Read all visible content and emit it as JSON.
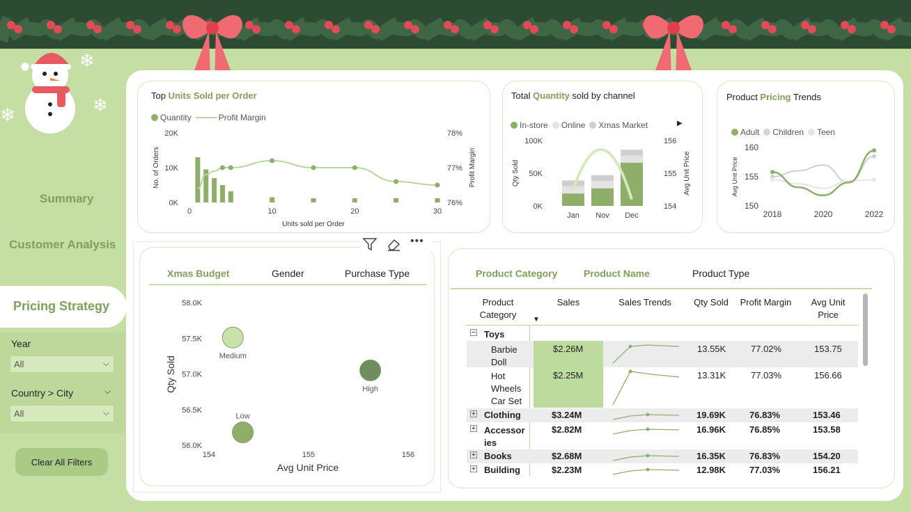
{
  "sidebar": {
    "nav": [
      {
        "label": "Summary"
      },
      {
        "label": "Customer Analysis"
      },
      {
        "label": "Pricing Strategy"
      }
    ],
    "filters": [
      {
        "label": "Year",
        "value": "All"
      },
      {
        "label": "Country > City",
        "value": "All"
      }
    ],
    "clear_label": "Clear All Filters"
  },
  "cards": {
    "units": {
      "title_pre": "Top ",
      "title_hl": "Units Sold per Order",
      "legend": [
        "Quantity",
        "Profit Margin"
      ]
    },
    "channel": {
      "title_pre": "Total ",
      "title_hl": "Quantity",
      "title_post": " sold by channel",
      "legend": [
        "In-store",
        "Online",
        "Xmas Market"
      ]
    },
    "pricing": {
      "title_pre": "Product ",
      "title_hl": "Pricing",
      "title_post": " Trends",
      "legend": [
        "Adult",
        "Children",
        "Teen"
      ]
    }
  },
  "visual_toolbar": {
    "icons": [
      "filter-icon",
      "eraser-icon",
      "more-icon"
    ]
  },
  "scatter_tabs": [
    "Xmas Budget",
    "Gender",
    "Purchase Type"
  ],
  "table_tabs": [
    "Product Category",
    "Product Name",
    "Product Type"
  ],
  "table": {
    "headers": [
      "Product\nCategory",
      "Sales",
      "Sales Trends",
      "Qty Sold",
      "Profit Margin",
      "Avg Unit\nPrice"
    ],
    "group": "Toys",
    "children": [
      {
        "name": "Barbie Doll",
        "sales": "$2.26M",
        "qty": "13.55K",
        "margin": "77.02%",
        "price": "153.75"
      },
      {
        "name": "Hot Wheels Car Set",
        "sales": "$2.25M",
        "qty": "13.31K",
        "margin": "77.03%",
        "price": "156.66"
      }
    ],
    "rows": [
      {
        "name": "Clothing",
        "sales": "$3.24M",
        "qty": "19.69K",
        "margin": "76.83%",
        "price": "153.46"
      },
      {
        "name": "Accessories",
        "sales": "$2.82M",
        "qty": "16.96K",
        "margin": "76.85%",
        "price": "153.58"
      },
      {
        "name": "Books",
        "sales": "$2.68M",
        "qty": "16.35K",
        "margin": "76.83%",
        "price": "154.20"
      },
      {
        "name": "Building",
        "sales": "$2.23M",
        "qty": "12.98K",
        "margin": "77.03%",
        "price": "156.21"
      }
    ]
  },
  "chart_data": [
    {
      "type": "bar",
      "title": "Top Units Sold per Order",
      "xlabel": "Units sold per Order",
      "ylabel": "No. of Orders",
      "y2label": "Profit Margin",
      "xticks": [
        "0",
        "10",
        "20",
        "30"
      ],
      "yticks": [
        "20K",
        "10K",
        "0K"
      ],
      "y2ticks": [
        "78%",
        "77%",
        "76%"
      ],
      "ylim": [
        0,
        20000
      ],
      "y2lim": [
        76,
        78
      ],
      "x": [
        1,
        2,
        3,
        4,
        5,
        10,
        15,
        20,
        25,
        30
      ],
      "series": [
        {
          "name": "Quantity",
          "values": [
            13000,
            9500,
            7000,
            5000,
            3200,
            1500,
            1200,
            1100,
            500,
            400
          ]
        },
        {
          "name": "Profit Margin",
          "values": [
            76.4,
            76.8,
            76.9,
            77.0,
            77.0,
            77.2,
            77.0,
            77.0,
            76.6,
            76.5
          ]
        }
      ]
    },
    {
      "type": "bar",
      "title": "Total Quantity sold by channel",
      "ylabel": "Qty Sold",
      "y2label": "Avg Unit Price",
      "categories": [
        "Jan",
        "Nov",
        "Dec"
      ],
      "yticks": [
        "100K",
        "50K",
        "0K"
      ],
      "y2ticks": [
        "156",
        "155",
        "154"
      ],
      "ylim": [
        0,
        100000
      ],
      "y2lim": [
        154,
        156
      ],
      "series": [
        {
          "name": "In-store",
          "values": [
            19000,
            27000,
            66000
          ]
        },
        {
          "name": "Online",
          "values": [
            11000,
            11000,
            11000
          ]
        },
        {
          "name": "Xmas Market",
          "values": [
            9000,
            9000,
            9000
          ]
        }
      ],
      "line": [
        154.5,
        155.6,
        154.2
      ]
    },
    {
      "type": "line",
      "title": "Product Pricing Trends",
      "ylabel": "Avg Unit Price",
      "x": [
        2018,
        2019,
        2020,
        2021,
        2022
      ],
      "xticks": [
        "2018",
        "2020",
        "2022"
      ],
      "yticks": [
        "160",
        "155",
        "150"
      ],
      "ylim": [
        150,
        160
      ],
      "series": [
        {
          "name": "Adult",
          "values": [
            155.8,
            153.2,
            151.8,
            154.0,
            159.5
          ]
        },
        {
          "name": "Children",
          "values": [
            155.0,
            156.0,
            157.0,
            154.0,
            158.5
          ]
        },
        {
          "name": "Teen",
          "values": [
            154.5,
            153.8,
            153.0,
            154.3,
            154.5
          ]
        }
      ]
    },
    {
      "type": "scatter",
      "xlabel": "Avg Unit Price",
      "ylabel": "Qty Sold",
      "xticks": [
        "154",
        "155",
        "156"
      ],
      "yticks": [
        "58.0K",
        "57.5K",
        "57.0K",
        "56.5K",
        "56.0K"
      ],
      "xlim": [
        154,
        156
      ],
      "ylim": [
        56000,
        58000
      ],
      "points": [
        {
          "label": "Medium",
          "x": 154.24,
          "y": 57510
        },
        {
          "label": "High",
          "x": 155.62,
          "y": 57050
        },
        {
          "label": "Low",
          "x": 154.34,
          "y": 56180
        }
      ]
    }
  ]
}
